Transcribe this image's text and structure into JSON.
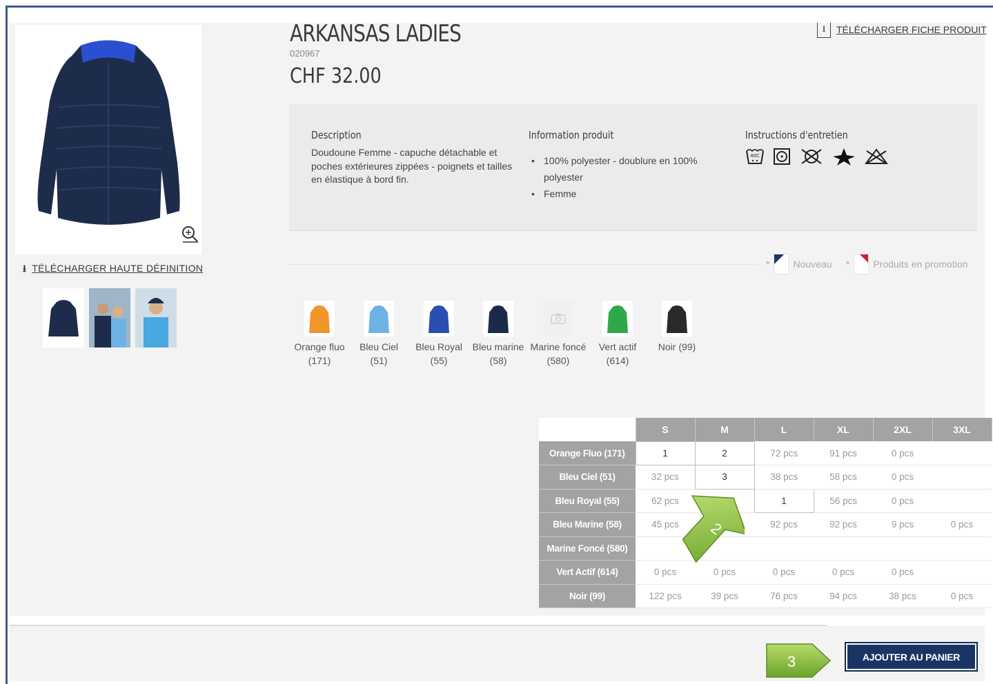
{
  "product": {
    "title": "ARKANSAS LADIES",
    "sku": "020967",
    "price": "CHF 32.00",
    "download_sheet_label": "TÉLÉCHARGER FICHE PRODUIT",
    "download_hd_label": "TÉLÉCHARGER HAUTE DÉFINITION"
  },
  "info": {
    "description_heading": "Description",
    "description_text": "Doudoune Femme - capuche détachable et poches extérieures zippées - poignets et tailles en élastique à bord fin.",
    "product_info_heading": "Information produit",
    "product_info_items": [
      "100% polyester - doublure en 100% polyester",
      "Femme"
    ],
    "care_heading": "Instructions d'entretien",
    "care_icons": [
      "wash-40c-icon",
      "tumble-dry-icon",
      "no-dry-clean-icon",
      "iron-icon",
      "no-bleach-icon"
    ]
  },
  "legend": {
    "new_label": "Nouveau",
    "promo_label": "Produits en promotion",
    "star": "*",
    "new_color": "#1a3464",
    "promo_color": "#cc2233"
  },
  "colors": [
    {
      "label": "Orange fluo (171)",
      "swatch": "#f0962a"
    },
    {
      "label": "Bleu Ciel (51)",
      "swatch": "#6fb3e6"
    },
    {
      "label": "Bleu Royal (55)",
      "swatch": "#2a4fb0"
    },
    {
      "label": "Bleu marine (58)",
      "swatch": "#1c2a4a"
    },
    {
      "label": "Marine foncé (580)",
      "swatch": "#f0f0f0"
    },
    {
      "label": "Vert actif (614)",
      "swatch": "#2fa84a"
    },
    {
      "label": "Noir (99)",
      "swatch": "#2a2a2a"
    }
  ],
  "size_table": {
    "sizes": [
      "S",
      "M",
      "L",
      "XL",
      "2XL",
      "3XL"
    ],
    "rows": [
      {
        "name": "Orange Fluo (171)",
        "cells": [
          "1",
          "2",
          "72 pcs",
          "91 pcs",
          "0 pcs",
          ""
        ]
      },
      {
        "name": "Bleu Ciel (51)",
        "cells": [
          "32 pcs",
          "3",
          "38 pcs",
          "58 pcs",
          "0 pcs",
          ""
        ]
      },
      {
        "name": "Bleu Royal (55)",
        "cells": [
          "62 pcs",
          "s",
          "1",
          "56 pcs",
          "0 pcs",
          ""
        ]
      },
      {
        "name": "Bleu Marine (58)",
        "cells": [
          "45 pcs",
          "s",
          "92 pcs",
          "92 pcs",
          "9 pcs",
          "0 pcs"
        ]
      },
      {
        "name": "Marine Foncé (580)",
        "cells": [
          "",
          "",
          "",
          "",
          "",
          ""
        ]
      },
      {
        "name": "Vert Actif (614)",
        "cells": [
          "0 pcs",
          "0 pcs",
          "0 pcs",
          "0 pcs",
          "0 pcs",
          ""
        ]
      },
      {
        "name": "Noir (99)",
        "cells": [
          "122 pcs",
          "39 pcs",
          "76 pcs",
          "94 pcs",
          "38 pcs",
          "0 pcs"
        ]
      }
    ],
    "qty_inputs": [
      [
        0,
        0
      ],
      [
        0,
        1
      ],
      [
        1,
        1
      ],
      [
        2,
        2
      ]
    ]
  },
  "cart": {
    "add_label": "AJOUTER AU PANIER"
  },
  "steps": {
    "step2": "2",
    "step3": "3",
    "arrow_color": "#8dc63f"
  }
}
